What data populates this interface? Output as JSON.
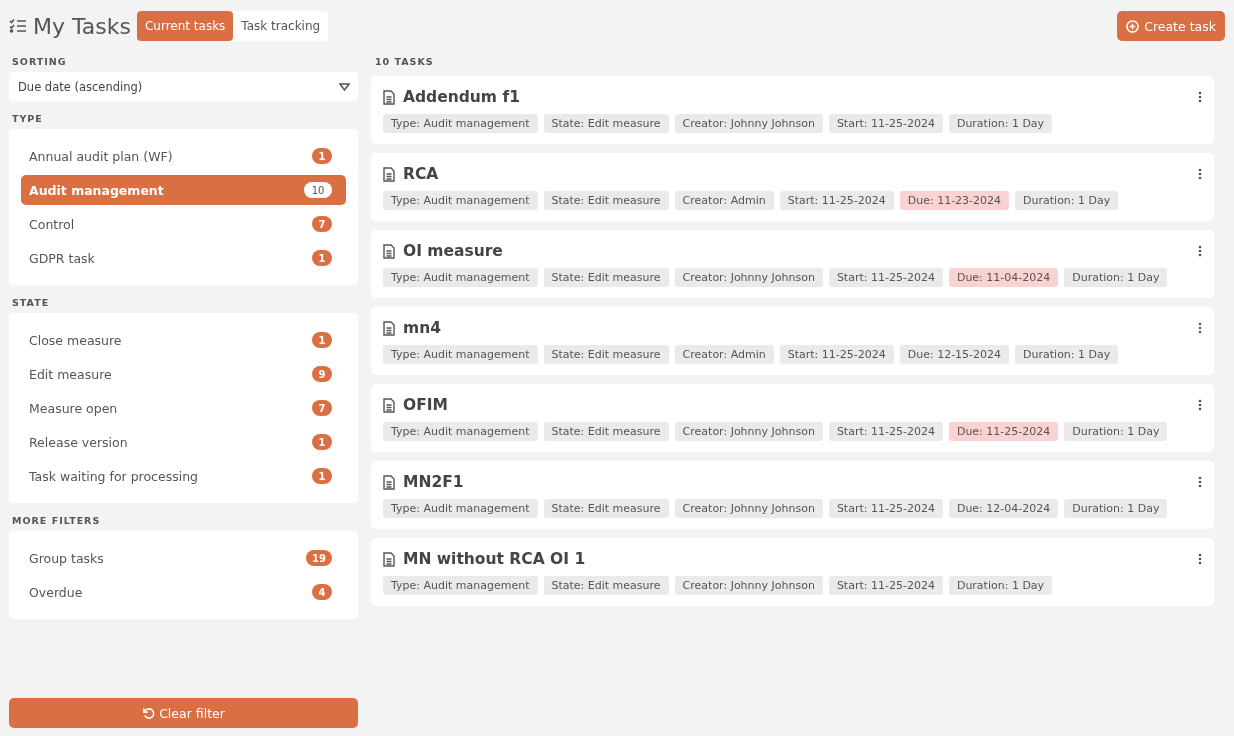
{
  "header": {
    "title": "My Tasks",
    "tabs": [
      {
        "label": "Current tasks",
        "selected": true
      },
      {
        "label": "Task tracking",
        "selected": false
      }
    ],
    "create_button": "Create task"
  },
  "sidebar": {
    "sorting": {
      "label": "SORTING",
      "value": "Due date (ascending)"
    },
    "groups": [
      {
        "title": "TYPE",
        "items": [
          {
            "label": "Annual audit plan (WF)",
            "count": "1",
            "selected": false
          },
          {
            "label": "Audit management",
            "count": "10",
            "selected": true
          },
          {
            "label": "Control",
            "count": "7",
            "selected": false
          },
          {
            "label": "GDPR task",
            "count": "1",
            "selected": false
          }
        ]
      },
      {
        "title": "STATE",
        "items": [
          {
            "label": "Close measure",
            "count": "1",
            "selected": false
          },
          {
            "label": "Edit measure",
            "count": "9",
            "selected": false
          },
          {
            "label": "Measure open",
            "count": "7",
            "selected": false
          },
          {
            "label": "Release version",
            "count": "1",
            "selected": false
          },
          {
            "label": "Task waiting for processing",
            "count": "1",
            "selected": false
          }
        ]
      },
      {
        "title": "MORE FILTERS",
        "items": [
          {
            "label": "Group tasks",
            "count": "19",
            "selected": false
          },
          {
            "label": "Overdue",
            "count": "4",
            "selected": false
          }
        ]
      }
    ],
    "clear_button": "Clear filter"
  },
  "tasks": {
    "count_label": "10 TASKS",
    "items": [
      {
        "title": "Addendum f1",
        "tags": [
          {
            "text": "Type: Audit management",
            "overdue": false
          },
          {
            "text": "State: Edit measure",
            "overdue": false
          },
          {
            "text": "Creator: Johnny Johnson",
            "overdue": false
          },
          {
            "text": "Start: 11-25-2024",
            "overdue": false
          },
          {
            "text": "Duration: 1 Day",
            "overdue": false
          }
        ]
      },
      {
        "title": "RCA",
        "tags": [
          {
            "text": "Type: Audit management",
            "overdue": false
          },
          {
            "text": "State: Edit measure",
            "overdue": false
          },
          {
            "text": "Creator: Admin",
            "overdue": false
          },
          {
            "text": "Start: 11-25-2024",
            "overdue": false
          },
          {
            "text": "Due: 11-23-2024",
            "overdue": true
          },
          {
            "text": "Duration: 1 Day",
            "overdue": false
          }
        ]
      },
      {
        "title": "OI measure",
        "tags": [
          {
            "text": "Type: Audit management",
            "overdue": false
          },
          {
            "text": "State: Edit measure",
            "overdue": false
          },
          {
            "text": "Creator: Johnny Johnson",
            "overdue": false
          },
          {
            "text": "Start: 11-25-2024",
            "overdue": false
          },
          {
            "text": "Due: 11-04-2024",
            "overdue": true
          },
          {
            "text": "Duration: 1 Day",
            "overdue": false
          }
        ]
      },
      {
        "title": "mn4",
        "tags": [
          {
            "text": "Type: Audit management",
            "overdue": false
          },
          {
            "text": "State: Edit measure",
            "overdue": false
          },
          {
            "text": "Creator: Admin",
            "overdue": false
          },
          {
            "text": "Start: 11-25-2024",
            "overdue": false
          },
          {
            "text": "Due: 12-15-2024",
            "overdue": false
          },
          {
            "text": "Duration: 1 Day",
            "overdue": false
          }
        ]
      },
      {
        "title": "OFIM",
        "tags": [
          {
            "text": "Type: Audit management",
            "overdue": false
          },
          {
            "text": "State: Edit measure",
            "overdue": false
          },
          {
            "text": "Creator: Johnny Johnson",
            "overdue": false
          },
          {
            "text": "Start: 11-25-2024",
            "overdue": false
          },
          {
            "text": "Due: 11-25-2024",
            "overdue": true
          },
          {
            "text": "Duration: 1 Day",
            "overdue": false
          }
        ]
      },
      {
        "title": "MN2F1",
        "tags": [
          {
            "text": "Type: Audit management",
            "overdue": false
          },
          {
            "text": "State: Edit measure",
            "overdue": false
          },
          {
            "text": "Creator: Johnny Johnson",
            "overdue": false
          },
          {
            "text": "Start: 11-25-2024",
            "overdue": false
          },
          {
            "text": "Due: 12-04-2024",
            "overdue": false
          },
          {
            "text": "Duration: 1 Day",
            "overdue": false
          }
        ]
      },
      {
        "title": "MN without RCA OI 1",
        "tags": [
          {
            "text": "Type: Audit management",
            "overdue": false
          },
          {
            "text": "State: Edit measure",
            "overdue": false
          },
          {
            "text": "Creator: Johnny Johnson",
            "overdue": false
          },
          {
            "text": "Start: 11-25-2024",
            "overdue": false
          },
          {
            "text": "Duration: 1 Day",
            "overdue": false
          }
        ]
      }
    ]
  }
}
